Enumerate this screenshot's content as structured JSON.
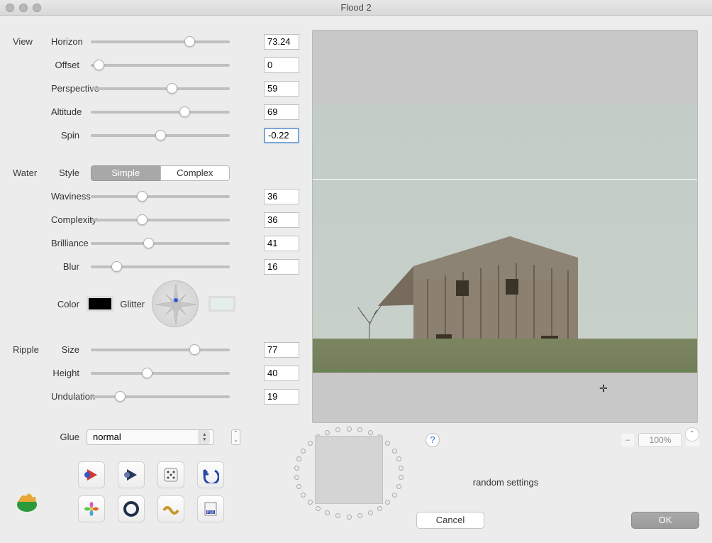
{
  "title": "Flood 2",
  "groups": {
    "view": {
      "label": "View",
      "params": {
        "horizon": {
          "label": "Horizon",
          "value": "73.24",
          "pos": 73
        },
        "offset": {
          "label": "Offset",
          "value": "0",
          "pos": 2
        },
        "perspective": {
          "label": "Perspective",
          "value": "59",
          "pos": 59
        },
        "altitude": {
          "label": "Altitude",
          "value": "69",
          "pos": 69
        },
        "spin": {
          "label": "Spin",
          "value": "-0.22",
          "pos": 50
        }
      }
    },
    "water": {
      "label": "Water",
      "style_label": "Style",
      "style_options": {
        "simple": "Simple",
        "complex": "Complex"
      },
      "style_active": "simple",
      "params": {
        "waviness": {
          "label": "Waviness",
          "value": "36",
          "pos": 36
        },
        "complexity": {
          "label": "Complexity",
          "value": "36",
          "pos": 36
        },
        "brilliance": {
          "label": "Brilliance",
          "value": "41",
          "pos": 41
        },
        "blur": {
          "label": "Blur",
          "value": "16",
          "pos": 16
        }
      },
      "color_label": "Color",
      "color_value": "#000000",
      "glitter_label": "Glitter",
      "glitter_value": "#e5efe9"
    },
    "ripple": {
      "label": "Ripple",
      "params": {
        "size": {
          "label": "Size",
          "value": "77",
          "pos": 77
        },
        "height": {
          "label": "Height",
          "value": "40",
          "pos": 40
        },
        "undulation": {
          "label": "Undulation",
          "value": "19",
          "pos": 19
        }
      }
    }
  },
  "glue": {
    "label": "Glue",
    "value": "normal",
    "options": [
      "normal"
    ]
  },
  "zoom": "100%",
  "random_label": "random settings",
  "buttons": {
    "cancel": "Cancel",
    "ok": "OK"
  },
  "icons": [
    "preset-icon",
    "play-dark-icon",
    "dice-icon",
    "undo-icon",
    "flower-icon",
    "ring-icon",
    "wave-icon",
    "psd-icon"
  ]
}
